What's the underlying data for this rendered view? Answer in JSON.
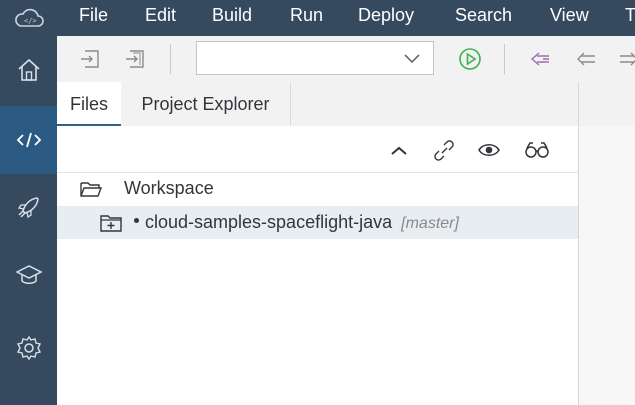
{
  "menu": {
    "items": [
      "File",
      "Edit",
      "Build",
      "Run",
      "Deploy",
      "Search",
      "View",
      "T"
    ]
  },
  "sidebar": {
    "items": [
      {
        "icon": "home-icon",
        "active": false
      },
      {
        "icon": "code-icon",
        "active": true
      },
      {
        "icon": "rocket-icon",
        "active": false
      },
      {
        "icon": "graduation-cap-icon",
        "active": false
      },
      {
        "icon": "gear-icon",
        "active": false
      }
    ]
  },
  "toolbar": {
    "select_value": ""
  },
  "tabs": {
    "files": "Files",
    "project_explorer": "Project Explorer"
  },
  "tree": {
    "workspace": "Workspace",
    "project": "cloud-samples-spaceflight-java",
    "branch": "[master]"
  },
  "colors": {
    "menubar": "#354a5f",
    "nav_active": "#2b5b83",
    "run_green": "#3fb24f",
    "nav_purple": "#9a6fb0"
  }
}
